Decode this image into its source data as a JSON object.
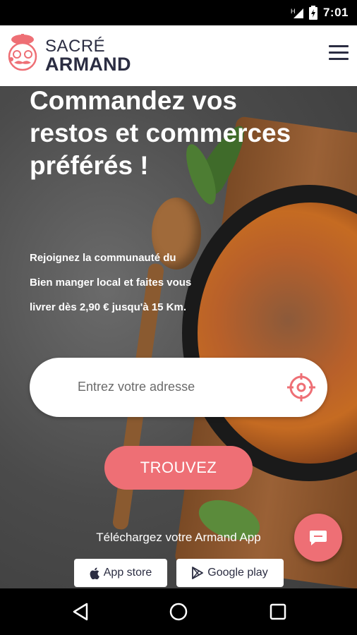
{
  "status_bar": {
    "time": "7:01",
    "icons": [
      "signal-icon",
      "battery-charging-icon"
    ]
  },
  "header": {
    "logo": {
      "line1": "SACRÉ",
      "line2": "ARMAND"
    },
    "menu_icon": "hamburger-icon"
  },
  "hero": {
    "headline": "Commandez vos restos et commerces préférés !",
    "subtext_lines": [
      "Rejoignez la communauté du",
      "Bien manger local et faites vous",
      "livrer dès 2,90 € jusqu'à 15 Km."
    ],
    "address_placeholder": "Entrez votre adresse",
    "cta_label": "TROUVEZ",
    "download_text": "Téléchargez votre Armand App",
    "stores": {
      "apple": "App store",
      "google": "Google play"
    }
  },
  "colors": {
    "accent": "#ee6f75",
    "navy": "#2b2d42"
  },
  "nav": {
    "icons": [
      "back-icon",
      "home-icon",
      "recents-icon"
    ]
  }
}
